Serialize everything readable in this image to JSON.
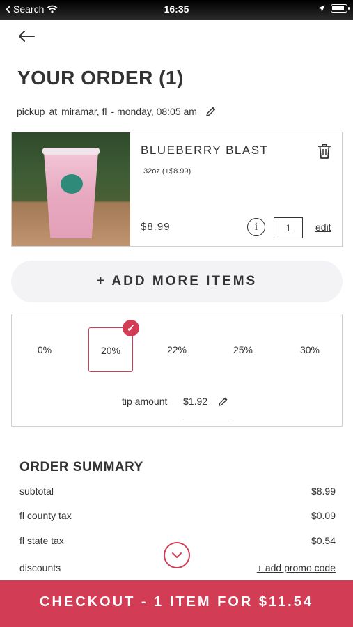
{
  "status_bar": {
    "back_label": "Search",
    "time": "16:35"
  },
  "page": {
    "title": "YOUR ORDER (1)"
  },
  "order_meta": {
    "mode": "pickup",
    "at": "at",
    "location": "miramar, fl",
    "when": "- monday, 08:05 am"
  },
  "item": {
    "name": "BLUEBERRY BLAST",
    "option": "32oz (+$8.99)",
    "price": "$8.99",
    "info_glyph": "i",
    "quantity": "1",
    "edit_label": "edit"
  },
  "add_more": {
    "label": "+ ADD MORE ITEMS"
  },
  "tip": {
    "options": [
      "0%",
      "20%",
      "22%",
      "25%",
      "30%"
    ],
    "selected": "20%",
    "check_glyph": "✓",
    "amount_label": "tip amount",
    "amount_value": "$1.92"
  },
  "summary": {
    "title": "ORDER SUMMARY",
    "rows": [
      {
        "label": "subtotal",
        "value": "$8.99"
      },
      {
        "label": "fl county tax",
        "value": "$0.09"
      },
      {
        "label": "fl state tax",
        "value": "$0.54"
      },
      {
        "label": "discounts",
        "value": "+ add promo code"
      }
    ]
  },
  "checkout": {
    "label": "CHECKOUT - 1 ITEM FOR $11.54"
  },
  "colors": {
    "accent": "#d23d55",
    "text": "#333333",
    "add_more_bg": "#f3f3f6",
    "border": "#cfcfcf"
  },
  "icons": {
    "back": "back-arrow-icon",
    "edit": "pencil-icon",
    "delete": "trash-icon",
    "info": "info-icon",
    "selected": "check-icon",
    "scroll": "chevron-down-icon"
  }
}
